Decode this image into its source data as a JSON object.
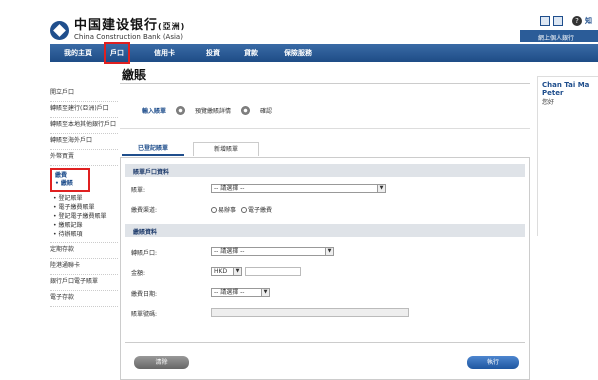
{
  "header": {
    "logo_cn": "中国建设银行",
    "logo_cn_suffix": "(亞洲)",
    "logo_en": "China Construction Bank (Asia)",
    "help_label": "知",
    "netbank_label": "網上個人銀行"
  },
  "nav": {
    "items": [
      {
        "label": "我的主頁"
      },
      {
        "label": "戶口"
      },
      {
        "label": "信用卡"
      },
      {
        "label": "投資"
      },
      {
        "label": "貸款"
      },
      {
        "label": "保險服務"
      }
    ]
  },
  "sidebar": {
    "items_top": [
      {
        "label": "開立戶口"
      },
      {
        "label": "轉賬至建行(亞洲)戶口"
      },
      {
        "label": "轉賬至本地其他銀行戶口"
      },
      {
        "label": "轉賬至海外戶口"
      },
      {
        "label": "外幣買賣"
      }
    ],
    "payment_heading": "繳費",
    "payment_active": "• 繳賬",
    "payment_subitems": [
      {
        "label": "登記賬單"
      },
      {
        "label": "電子繳費賬單"
      },
      {
        "label": "登記電子繳費賬單"
      },
      {
        "label": "繳賬記錄"
      },
      {
        "label": "待辦賬項"
      }
    ],
    "items_bottom": [
      {
        "label": "定期存款"
      },
      {
        "label": "陸港通聯卡"
      },
      {
        "label": "銀行戶口電子賬單"
      },
      {
        "label": "電子存款"
      }
    ]
  },
  "main": {
    "title": "繳賬",
    "steps": [
      {
        "label": "輸入賬單"
      },
      {
        "label": "預覽繳賬詳情"
      },
      {
        "label": "確認"
      }
    ],
    "tabs": [
      {
        "label": "已登記賬單"
      },
      {
        "label": "新增賬單"
      }
    ],
    "section1": {
      "heading": "賬單戶口資料",
      "bill_label": "賬單:",
      "bill_value": "-- 請選擇 --",
      "channel_label": "繳費渠道:",
      "channel_opt1": "易辦事",
      "channel_opt2": "電子繳費"
    },
    "section2": {
      "heading": "繳賬資料",
      "account_label": "轉賬戶口:",
      "account_value": "-- 請選擇 --",
      "amount_label": "金額:",
      "currency_value": "HKD",
      "date_label": "繳費日期:",
      "date_value": "-- 請選擇 --",
      "bill_no_label": "賬單號碼:"
    },
    "clear_button": "清除",
    "execute_button": "執行"
  },
  "user": {
    "name": "Chan Tai Ma Peter",
    "greeting": "您好"
  }
}
